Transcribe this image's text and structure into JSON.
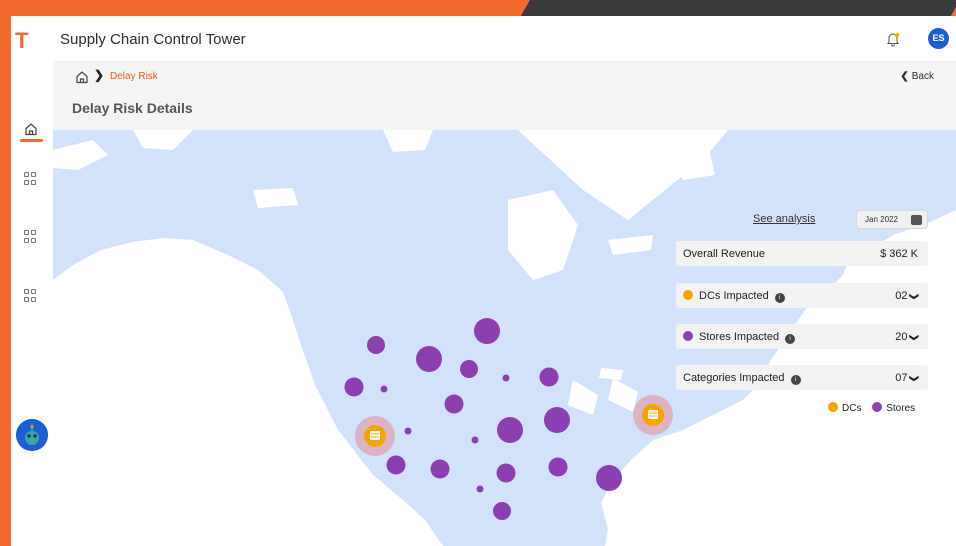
{
  "app": {
    "logo": "T",
    "title": "Supply Chain Control Tower"
  },
  "user": {
    "initials": "ES"
  },
  "breadcrumb": {
    "current": "Delay Risk"
  },
  "back_label": "Back",
  "page_title": "Delay Risk Details",
  "analysis_link": "See analysis",
  "date_filter": "Jan 2022",
  "kpis": {
    "revenue": {
      "label": "Overall Revenue",
      "value": "$ 362 K"
    },
    "dcs": {
      "label": "DCs Impacted",
      "value": "02"
    },
    "stores": {
      "label": "Stores Impacted",
      "value": "20"
    },
    "categories": {
      "label": "Categories Impacted",
      "value": "07"
    }
  },
  "legend": {
    "dcs": "DCs",
    "stores": "Stores"
  },
  "icons": {
    "sidebar": [
      "home-icon",
      "grid-icon",
      "grid-icon",
      "grid-icon"
    ],
    "header": [
      "bell-icon"
    ],
    "kpi": [
      "info-icon",
      "chevron-down-icon"
    ],
    "map": [
      "warehouse-icon"
    ]
  },
  "colors": {
    "accent": "#f26a2e",
    "breadcrumb": "#e35d1c",
    "store": "#8b3fb0",
    "dc": "#f5a400",
    "land": "#d3e2fb",
    "avatar": "#1b5fd6"
  }
}
